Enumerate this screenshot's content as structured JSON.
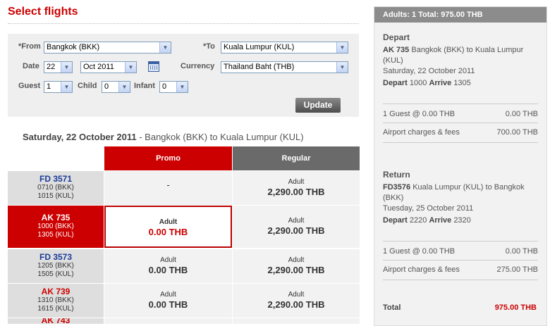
{
  "page": {
    "title": "Select flights"
  },
  "search": {
    "from_label": "*From",
    "from_value": "Bangkok (BKK)",
    "to_label": "*To",
    "to_value": "Kuala Lumpur (KUL)",
    "date_label": "Date",
    "date_day": "22",
    "date_month": "Oct 2011",
    "currency_label": "Currency",
    "currency_value": "Thailand Baht (THB)",
    "guest_label": "Guest",
    "guest_value": "1",
    "child_label": "Child",
    "child_value": "0",
    "infant_label": "Infant",
    "infant_value": "0",
    "update_label": "Update"
  },
  "results": {
    "date_bold": "Saturday, 22 October 2011",
    "route": " - Bangkok (BKK)  to  Kuala Lumpur (KUL)",
    "col_promo": "Promo",
    "col_regular": "Regular",
    "rows": [
      {
        "code": "FD  3571",
        "dep": "0710  (BKK)",
        "arr": "1015  (KUL)",
        "promo_dash": "-",
        "regular_type": "Adult",
        "regular_price": "2,290.00 THB"
      },
      {
        "code": "AK  735",
        "dep": "1000  (BKK)",
        "arr": "1305  (KUL)",
        "promo_type": "Adult",
        "promo_price": "0.00 THB",
        "regular_type": "Adult",
        "regular_price": "2,290.00 THB"
      },
      {
        "code": "FD  3573",
        "dep": "1205  (BKK)",
        "arr": "1505  (KUL)",
        "promo_type": "Adult",
        "promo_price": "0.00 THB",
        "regular_type": "Adult",
        "regular_price": "2,290.00 THB"
      },
      {
        "code": "AK  739",
        "dep": "1310  (BKK)",
        "arr": "1615  (KUL)",
        "promo_type": "Adult",
        "promo_price": "0.00 THB",
        "regular_type": "Adult",
        "regular_price": "2,290.00 THB"
      }
    ],
    "partial_code": "AK  743"
  },
  "summary": {
    "header": "Adults: 1  Total: 975.00 THB",
    "depart": {
      "title": "Depart",
      "flight": "AK 735",
      "route": "Bangkok (BKK) to Kuala Lumpur (KUL)",
      "date": "Saturday, 22 October 2011",
      "depart_label": "Depart",
      "depart_time": "1000",
      "arrive_label": "Arrive",
      "arrive_time": "1305",
      "guest_line": "1 Guest @ 0.00 THB",
      "guest_amount": "0.00 THB",
      "fees_label": "Airport charges & fees",
      "fees_amount": "700.00 THB"
    },
    "return": {
      "title": "Return",
      "flight": "FD3576",
      "route": "Kuala Lumpur (KUL) to Bangkok (BKK)",
      "date": "Tuesday, 25 October 2011",
      "depart_label": "Depart",
      "depart_time": "2220",
      "arrive_label": "Arrive",
      "arrive_time": "2320",
      "guest_line": "1 Guest @ 0.00 THB",
      "guest_amount": "0.00 THB",
      "fees_label": "Airport charges & fees",
      "fees_amount": "275.00 THB"
    },
    "total_label": "Total",
    "total_amount": "975.00 THB"
  },
  "colors": {
    "accent": "#cc0000",
    "link_blue": "#1a3a9a",
    "header_grey": "#8c8c8c"
  }
}
